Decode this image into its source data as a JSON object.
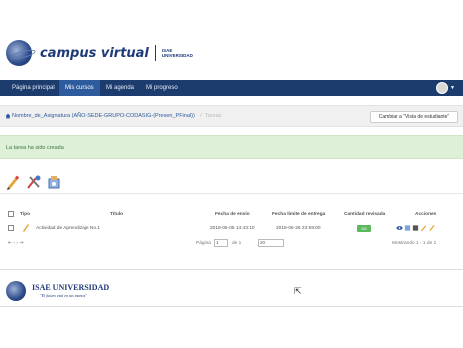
{
  "brand": {
    "title": "campus virtual",
    "subtitle": "ISAE UNIVERSIDAD"
  },
  "nav": {
    "items": [
      {
        "label": "Página principal"
      },
      {
        "label": "Mis cursos"
      },
      {
        "label": "Mi agenda"
      },
      {
        "label": "Mi progreso"
      }
    ],
    "active_index": 1
  },
  "breadcrumb": {
    "course": "Nombre_de_Asignatura (AÑO-SEDE-GRUPO-CODASIG-(Presen_PFinal))",
    "separator": "/",
    "current": "Tareas"
  },
  "switch_view_button": "Cambiar a \"Vista de estudiante\"",
  "alert": {
    "text": "La tarea ha sido creada"
  },
  "toolbar": {
    "icons": [
      "create-assignment-icon",
      "add-tool-icon",
      "settings-icon"
    ]
  },
  "table": {
    "headers": {
      "type": "Tipo",
      "title": "Título",
      "sent_date": "Fecha de envío",
      "deadline": "Fecha límite de entrega",
      "graded_count": "Cantidad revisada",
      "actions": "Acciones"
    },
    "rows": [
      {
        "title": "Actividad de Aprendizaje No.1",
        "sent_date": "2018-05-05 14:43:10",
        "deadline": "2018-05-26 23:59:00",
        "graded": "0/0"
      }
    ]
  },
  "pagination": {
    "prefix": "Página",
    "page": "1",
    "of_label": "de 1",
    "per_page": "20",
    "summary": "Mostrando 1 - 1 de 1"
  },
  "footer": {
    "name": "ISAE UNIVERSIDAD",
    "slogan": "\"El futuro está en tus manos\""
  },
  "colors": {
    "nav_bg": "#1d3c6e",
    "nav_active": "#2e5b9e",
    "alert_bg": "#dff0d8",
    "alert_text": "#3c763d",
    "badge": "#5cb85c"
  }
}
